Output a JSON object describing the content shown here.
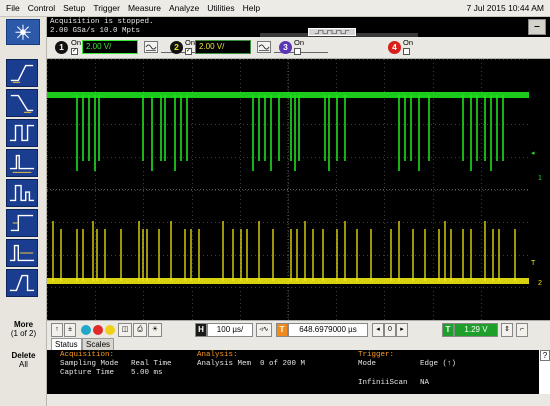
{
  "menu": {
    "items": [
      "File",
      "Control",
      "Setup",
      "Trigger",
      "Measure",
      "Analyze",
      "Utilities",
      "Help"
    ],
    "datetime": "7 Jul 2015 10:44 AM"
  },
  "acquisition": {
    "status": "Acquisition is stopped.",
    "rate": "2.00 GSa/s   10.0 Mpts"
  },
  "channels": [
    {
      "number": "1",
      "on_label": "On",
      "checked": true,
      "scale": "2.00 V/",
      "color": "#00e600"
    },
    {
      "number": "2",
      "on_label": "On",
      "checked": true,
      "scale": "2.00 V/",
      "color": "#f2e600"
    },
    {
      "number": "3",
      "on_label": "On",
      "checked": false,
      "color": "#6a3fc7"
    },
    {
      "number": "4",
      "on_label": "On",
      "checked": false,
      "color": "#e6221e"
    }
  ],
  "side": {
    "more_label": "More",
    "more_sub": "(1 of 2)",
    "delete_label": "Delete",
    "delete_sub": "All"
  },
  "controls": {
    "horizontal_badge": "H",
    "time_scale": "100 µs/",
    "trigger_badge": "T",
    "time_position": "648.6979000 µs",
    "trigger_level_badge": "T",
    "trigger_level": "1.29 V"
  },
  "tabs": [
    "Status",
    "Scales"
  ],
  "info": {
    "acq_header": "Acquisition:",
    "sampling_mode_label": "Sampling Mode",
    "sampling_mode_value": "Real Time",
    "capture_time_label": "Capture Time",
    "capture_time_value": "5.00 ms",
    "analysis_header": "Analysis:",
    "analysis_mem_label": "Analysis Mem",
    "analysis_mem_value": "0 of 200 M",
    "trigger_header": "Trigger:",
    "mode_label": "Mode",
    "mode_value": "Edge (↑)",
    "infiniiscan_label": "InfiniiScan",
    "infiniiscan_value": "NA"
  },
  "markers": {
    "ch1_level": "1",
    "ch2_level": "2",
    "trigger_level": "T"
  },
  "traces": {
    "ch1_color": "#1fe01f",
    "ch2_color": "#f0e812"
  }
}
